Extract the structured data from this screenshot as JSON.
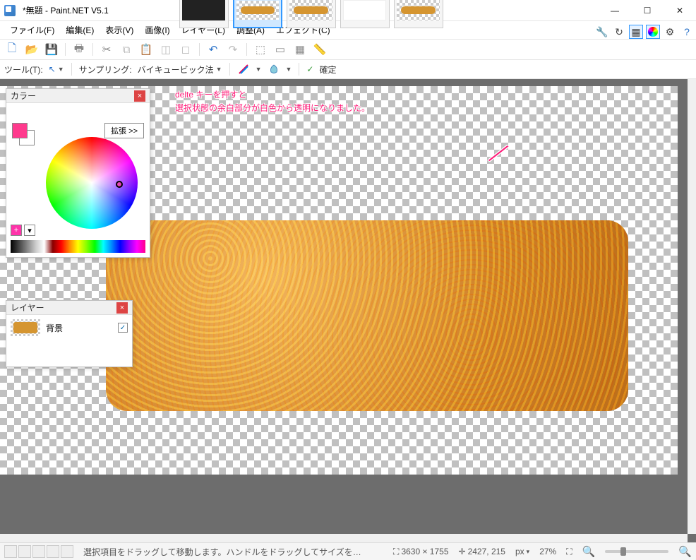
{
  "title": "*無題 - Paint.NET V5.1",
  "menubar": {
    "file": "ファイル(F)",
    "edit": "編集(E)",
    "view": "表示(V)",
    "image": "画像(I)",
    "layer": "レイヤー(L)",
    "adjust": "調整(A)",
    "effect": "エフェクト(C)"
  },
  "tool_options": {
    "tool_label": "ツール(T):",
    "sampling_label": "サンプリング:",
    "sampling_value": "バイキュービック法",
    "commit_label": "確定"
  },
  "color_panel": {
    "title": "カラー",
    "expand_label": "拡張 >>",
    "primary_color": "#ff3a8d",
    "secondary_color": "#ffffff"
  },
  "layers_panel": {
    "title": "レイヤー",
    "layer_name": "背景",
    "visible": true
  },
  "annotation": {
    "line1": "delte キーを押すと",
    "line2": "選択状態の余白部分が白色から透明になりました。"
  },
  "statusbar": {
    "hint": "選択項目をドラッグして移動します。ハンドルをドラッグしてサイズを変更します。マウスの右ボタンでドラッグして回転します。",
    "image_size": "3630 × 1755",
    "cursor_pos": "2427, 215",
    "unit": "px",
    "zoom": "27%"
  },
  "thumbnails": {
    "count": 5,
    "selected_index": 1
  },
  "window_controls": {
    "minimize": "—",
    "maximize": "☐",
    "close": "✕"
  }
}
